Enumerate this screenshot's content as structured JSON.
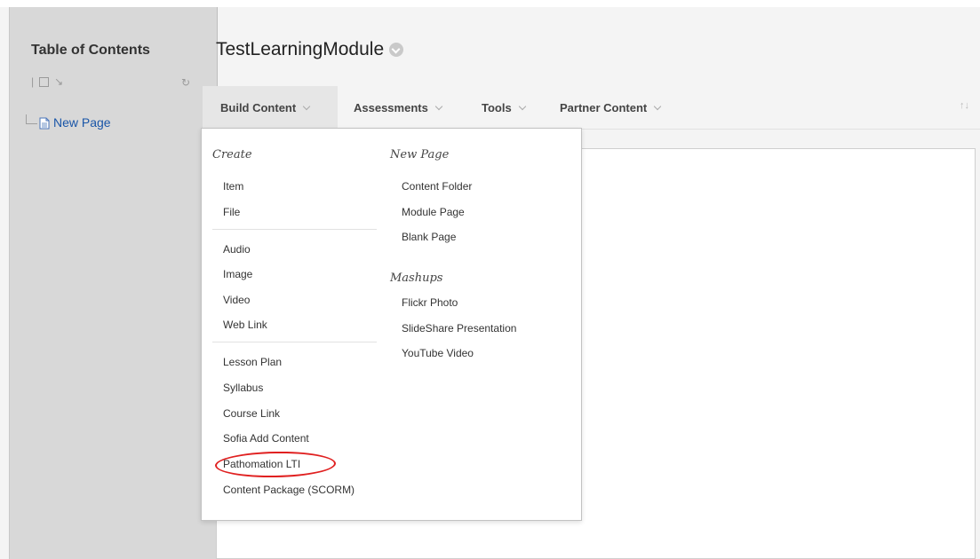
{
  "sidebar": {
    "title": "Table of Contents",
    "items": [
      {
        "label": "New Page"
      }
    ]
  },
  "header": {
    "title": "TestLearningModule"
  },
  "action_bar": {
    "buttons": [
      {
        "label": "Build Content"
      },
      {
        "label": "Assessments"
      },
      {
        "label": "Tools"
      },
      {
        "label": "Partner Content"
      }
    ]
  },
  "dropdown": {
    "create": {
      "heading": "Create",
      "group1": [
        "Item",
        "File"
      ],
      "group2": [
        "Audio",
        "Image",
        "Video",
        "Web Link"
      ],
      "group3": [
        "Lesson Plan",
        "Syllabus",
        "Course Link",
        "Sofia Add Content",
        "Pathomation LTI",
        "Content Package (SCORM)"
      ]
    },
    "new_page": {
      "heading": "New Page",
      "items": [
        "Content Folder",
        "Module Page",
        "Blank Page"
      ]
    },
    "mashups": {
      "heading": "Mashups",
      "items": [
        "Flickr Photo",
        "SlideShare Presentation",
        "YouTube Video"
      ]
    }
  },
  "colors": {
    "highlight": "#e02020",
    "link": "#1a56a8",
    "sidebar_bg": "#d8d8d8"
  }
}
